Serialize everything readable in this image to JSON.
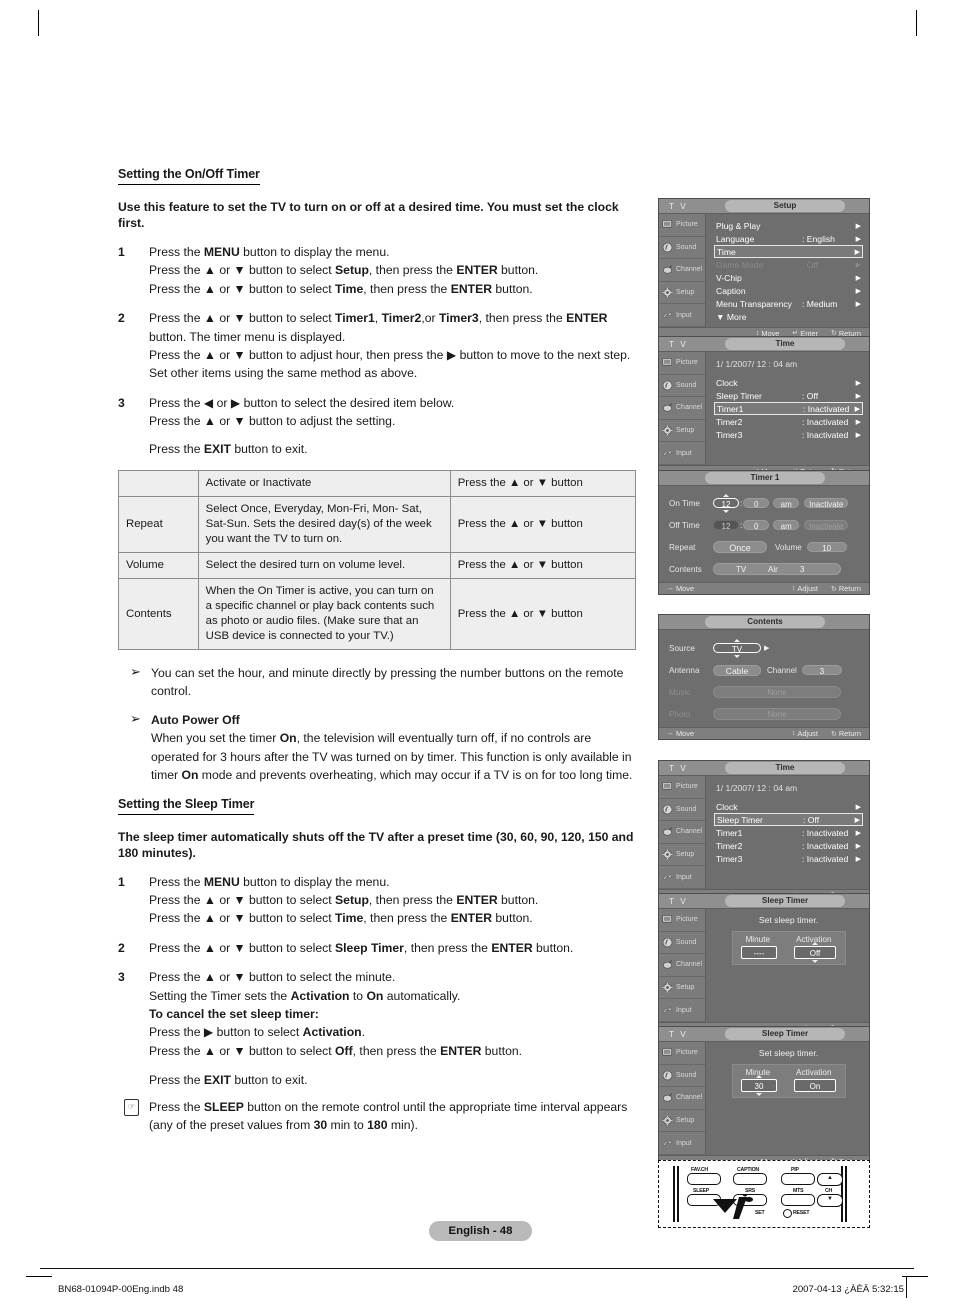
{
  "document": {
    "section1_heading": "Setting the On/Off Timer",
    "section1_lead": "Use this feature to set the TV to turn on or off at a desired time. You must set the clock first.",
    "section2_heading": "Setting the Sleep Timer",
    "section2_lead": "The sleep timer automatically shuts off the TV after a preset time (30, 60, 90, 120, 150 and 180 minutes).",
    "page_badge": "English - 48",
    "footer_left": "BN68-01094P-00Eng.indb   48",
    "footer_right": "2007-04-13   ¿ÀÈÄ 5:32:15"
  },
  "steps1": [
    {
      "num": "1",
      "lines": [
        "Press the <b>MENU</b> button to display the menu.",
        "Press the ▲ or ▼ button to select <b>Setup</b>, then press the <b>ENTER</b> button.",
        "Press the ▲ or ▼ button to select <b>Time</b>, then press the <b>ENTER</b> button."
      ]
    },
    {
      "num": "2",
      "lines": [
        "Press the ▲ or ▼ button to select <b>Timer1</b>, <b>Timer2</b>,or <b>Timer3</b>, then press the <b>ENTER</b> button. The timer menu is displayed.",
        "Press the ▲ or ▼ button to adjust hour, then press the ▶ button to move to the next step. Set other items using the same method as above."
      ]
    },
    {
      "num": "3",
      "lines": [
        "Press the ◀ or ▶ button to select the desired item below.",
        "Press the ▲ or ▼ button to adjust the setting."
      ]
    }
  ],
  "exit_line_1": "Press the <b>EXIT</b> button to exit.",
  "table": {
    "rows": [
      {
        "label": "",
        "description": "Activate or Inactivate",
        "action": "Press the ▲ or ▼ button"
      },
      {
        "label": "Repeat",
        "description": "Select Once, Everyday, Mon-Fri, Mon- Sat, Sat-Sun. Sets the desired day(s) of the week you want the TV to turn on.",
        "action": "Press the ▲ or ▼ button"
      },
      {
        "label": "Volume",
        "description": "Select the desired turn on volume level.",
        "action": "Press the ▲ or ▼ button"
      },
      {
        "label": "Contents",
        "description": "When the On Timer is active, you can turn on a specific channel or play back contents such as photo or audio files. (Make sure that an USB device is connected to your TV.)",
        "action": "Press the ▲ or ▼ button"
      }
    ]
  },
  "notes": [
    {
      "bullet": "➢",
      "heading": "",
      "text": "You can set the hour, and minute directly by pressing the number buttons on the remote control."
    },
    {
      "bullet": "➢",
      "heading": "Auto Power Off",
      "text": "When you set the timer <b>On</b>, the television will eventually turn off, if no controls are operated for 3 hours after the TV was turned on by timer. This function is only available in timer <b>On</b> mode and prevents overheating, which may occur if a TV is on for too long time."
    }
  ],
  "steps2": [
    {
      "num": "1",
      "lines": [
        "Press the <b>MENU</b> button to display the menu.",
        "Press the ▲ or ▼ button to select <b>Setup</b>, then press the <b>ENTER</b> button.",
        "Press the ▲ or ▼ button to select <b>Time</b>, then press the <b>ENTER</b> button."
      ]
    },
    {
      "num": "2",
      "lines": [
        "Press the ▲ or ▼ button to select <b>Sleep Timer</b>, then press the <b>ENTER</b> button."
      ]
    },
    {
      "num": "3",
      "lines": [
        "Press the ▲ or ▼ button to select the minute.",
        "Setting the Timer sets the <b>Activation</b> to <b>On</b> automatically.",
        "<b>To cancel the set sleep timer:</b>",
        "Press the ▶ button to select <b>Activation</b>.",
        "Press the ▲ or ▼ button to select <b>Off</b>, then press the <b>ENTER</b> button."
      ]
    }
  ],
  "exit_line_2": "Press the <b>EXIT</b> button to exit.",
  "sleep_note": "Press the <b>SLEEP</b> button on the remote control until the appropriate time interval appears (any of the preset values from <b>30</b> min to <b>180</b> min).",
  "osd": {
    "tv_label": "T V",
    "rail": [
      {
        "label": "Picture",
        "icon": "picture-icon"
      },
      {
        "label": "Sound",
        "icon": "sound-icon"
      },
      {
        "label": "Channel",
        "icon": "channel-icon"
      },
      {
        "label": "Setup",
        "icon": "setup-icon"
      },
      {
        "label": "Input",
        "icon": "input-icon"
      }
    ],
    "footbar": {
      "move": "Move",
      "enter": "Enter",
      "return": "Return",
      "adjust": "Adjust"
    },
    "panel_setup": {
      "title": "Setup",
      "rows": [
        {
          "label": "Plug & Play",
          "value": "",
          "chevron": "▶",
          "state": "normal"
        },
        {
          "label": "Language",
          "value": ": English",
          "chevron": "▶",
          "state": "normal"
        },
        {
          "label": "Time",
          "value": "",
          "chevron": "▶",
          "state": "selected"
        },
        {
          "label": "Game Mode",
          "value": ": Off",
          "chevron": "▶",
          "state": "dim"
        },
        {
          "label": "V-Chip",
          "value": "",
          "chevron": "▶",
          "state": "normal"
        },
        {
          "label": "Caption",
          "value": "",
          "chevron": "▶",
          "state": "normal"
        },
        {
          "label": "Menu Transparency",
          "value": ": Medium",
          "chevron": "▶",
          "state": "normal"
        },
        {
          "label": "▼  More",
          "value": "",
          "chevron": "",
          "state": "normal"
        }
      ]
    },
    "panel_time_timer1": {
      "title": "Time",
      "clock": "1/ 1/2007/ 12 : 04  am",
      "rows": [
        {
          "label": "Clock",
          "value": "",
          "chevron": "▶",
          "state": "normal"
        },
        {
          "label": "Sleep Timer",
          "value": ": Off",
          "chevron": "▶",
          "state": "normal"
        },
        {
          "label": "Timer1",
          "value": ": Inactivated",
          "chevron": "▶",
          "state": "selected"
        },
        {
          "label": "Timer2",
          "value": ": Inactivated",
          "chevron": "▶",
          "state": "normal"
        },
        {
          "label": "Timer3",
          "value": ": Inactivated",
          "chevron": "▶",
          "state": "normal"
        }
      ]
    },
    "panel_timer1": {
      "title": "Timer 1",
      "on_time": {
        "label": "On Time",
        "hour": "12",
        "minute": "0",
        "ampm": "am",
        "activation": "Inactivate"
      },
      "off_time": {
        "label": "Off Time",
        "hour": "12",
        "minute": "0",
        "ampm": "am",
        "activation": "Inactivate"
      },
      "repeat": {
        "label": "Repeat",
        "value": "Once"
      },
      "volume": {
        "label": "Volume",
        "value": "10"
      },
      "contents": {
        "label": "Contents",
        "source": "TV",
        "antenna": "Air",
        "channel": "3"
      }
    },
    "panel_contents": {
      "title": "Contents",
      "source": {
        "label": "Source",
        "value": "TV"
      },
      "antenna": {
        "label": "Antenna",
        "value": "Cable"
      },
      "channel": {
        "label": "Channel",
        "value": "3"
      },
      "music": {
        "label": "Music",
        "value": "None"
      },
      "photo": {
        "label": "Photo",
        "value": "None"
      }
    },
    "panel_time_sleep": {
      "title": "Time",
      "clock": "1/ 1/2007/ 12 : 04  am",
      "rows": [
        {
          "label": "Clock",
          "value": "",
          "chevron": "▶",
          "state": "normal"
        },
        {
          "label": "Sleep Timer",
          "value": ": Off",
          "chevron": "▶",
          "state": "selected"
        },
        {
          "label": "Timer1",
          "value": ": Inactivated",
          "chevron": "▶",
          "state": "normal"
        },
        {
          "label": "Timer2",
          "value": ": Inactivated",
          "chevron": "▶",
          "state": "normal"
        },
        {
          "label": "Timer3",
          "value": ": Inactivated",
          "chevron": "▶",
          "state": "normal"
        }
      ]
    },
    "panel_sleep_off": {
      "title": "Sleep Timer",
      "prompt": "Set sleep timer.",
      "minute_label": "Minute",
      "activation_label": "Activation",
      "minute_value": "----",
      "activation_value": "Off"
    },
    "panel_sleep_on": {
      "title": "Sleep Timer",
      "prompt": "Set sleep timer.",
      "minute_label": "Minute",
      "activation_label": "Activation",
      "minute_value": "30",
      "activation_value": "On"
    }
  },
  "remote": {
    "labels": [
      "FAV.CH",
      "CAPTION",
      "PIP",
      "SLEEP",
      "SRS",
      "MTS",
      "CH"
    ],
    "set_label": "SET",
    "reset_label": "RESET"
  }
}
